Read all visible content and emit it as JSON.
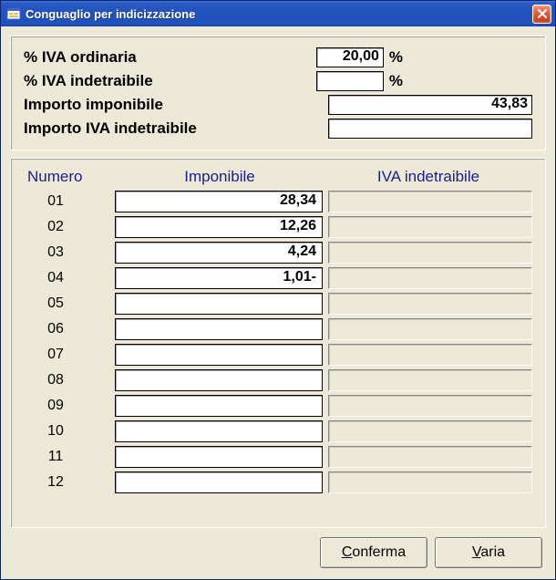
{
  "window": {
    "title": "Conguaglio per indicizzazione"
  },
  "top": {
    "iva_ordinaria_label": "% IVA ordinaria",
    "iva_ordinaria_value": "20,00",
    "iva_ordinaria_unit": "%",
    "iva_indetraibile_label": "% IVA indetraibile",
    "iva_indetraibile_value": "",
    "iva_indetraibile_unit": "%",
    "importo_imponibile_label": "Importo imponibile",
    "importo_imponibile_value": "43,83",
    "importo_iva_indetraibile_label": "Importo IVA indetraibile",
    "importo_iva_indetraibile_value": ""
  },
  "grid": {
    "headers": {
      "numero": "Numero",
      "imponibile": "Imponibile",
      "iva_indetraibile": "IVA indetraibile"
    },
    "rows": [
      {
        "num": "01",
        "imponibile": "28,34",
        "iva": ""
      },
      {
        "num": "02",
        "imponibile": "12,26",
        "iva": ""
      },
      {
        "num": "03",
        "imponibile": "4,24",
        "iva": ""
      },
      {
        "num": "04",
        "imponibile": "1,01-",
        "iva": ""
      },
      {
        "num": "05",
        "imponibile": "",
        "iva": ""
      },
      {
        "num": "06",
        "imponibile": "",
        "iva": ""
      },
      {
        "num": "07",
        "imponibile": "",
        "iva": ""
      },
      {
        "num": "08",
        "imponibile": "",
        "iva": ""
      },
      {
        "num": "09",
        "imponibile": "",
        "iva": ""
      },
      {
        "num": "10",
        "imponibile": "",
        "iva": ""
      },
      {
        "num": "11",
        "imponibile": "",
        "iva": ""
      },
      {
        "num": "12",
        "imponibile": "",
        "iva": ""
      }
    ]
  },
  "buttons": {
    "conferma": "Conferma",
    "varia": "Varia"
  }
}
